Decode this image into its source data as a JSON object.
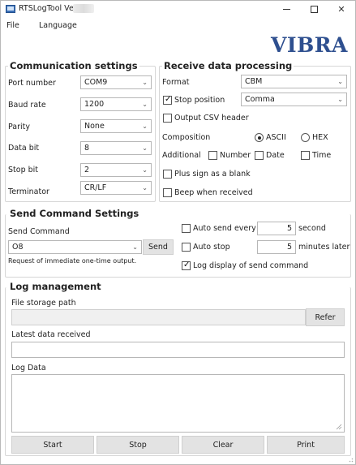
{
  "window": {
    "title": "RTSLogTool  Ver."
  },
  "menu": {
    "file": "File",
    "language": "Language"
  },
  "logo": "VIBRA",
  "communication": {
    "title": "Communication settings",
    "port_number": {
      "label": "Port number",
      "value": "COM9"
    },
    "baud_rate": {
      "label": "Baud rate",
      "value": "1200"
    },
    "parity": {
      "label": "Parity",
      "value": "None"
    },
    "data_bit": {
      "label": "Data bit",
      "value": "8"
    },
    "stop_bit": {
      "label": "Stop bit",
      "value": "2"
    },
    "terminator": {
      "label": "Terminator",
      "value": "CR/LF"
    }
  },
  "receive": {
    "title": "Receive data processing",
    "format": {
      "label": "Format",
      "value": "CBM"
    },
    "stop_position": {
      "label": "Stop position",
      "checked": true,
      "value": "Comma"
    },
    "output_csv_header": {
      "label": "Output CSV header",
      "checked": false
    },
    "composition": {
      "label": "Composition",
      "options": [
        "ASCII",
        "HEX"
      ],
      "selected": "ASCII"
    },
    "additional": {
      "label": "Additional",
      "options": [
        "Number",
        "Date",
        "Time"
      ]
    },
    "plus_sign_blank": {
      "label": "Plus sign as a blank",
      "checked": false
    },
    "beep_when_received": {
      "label": "Beep when received",
      "checked": false
    }
  },
  "send_command": {
    "title": "Send Command Settings",
    "command_label": "Send Command",
    "command_value": "O8",
    "send_button": "Send",
    "hint": "Request of immediate one-time output.",
    "auto_send": {
      "label": "Auto send every",
      "value": "5",
      "unit": "second",
      "checked": false
    },
    "auto_stop": {
      "label": "Auto stop",
      "value": "5",
      "unit": "minutes later",
      "checked": false
    },
    "log_display": {
      "label": "Log display of send command",
      "checked": true
    }
  },
  "log": {
    "title": "Log management",
    "file_path_label": "File storage path",
    "file_path_value": "",
    "refer_button": "Refer",
    "latest_label": "Latest data received",
    "latest_value": "",
    "log_data_label": "Log Data",
    "log_data_value": ""
  },
  "buttons": {
    "start": "Start",
    "stop": "Stop",
    "clear": "Clear",
    "print": "Print"
  },
  "colors": {
    "logo": "#2e4f8f",
    "button_bg": "#e3e3e3"
  }
}
